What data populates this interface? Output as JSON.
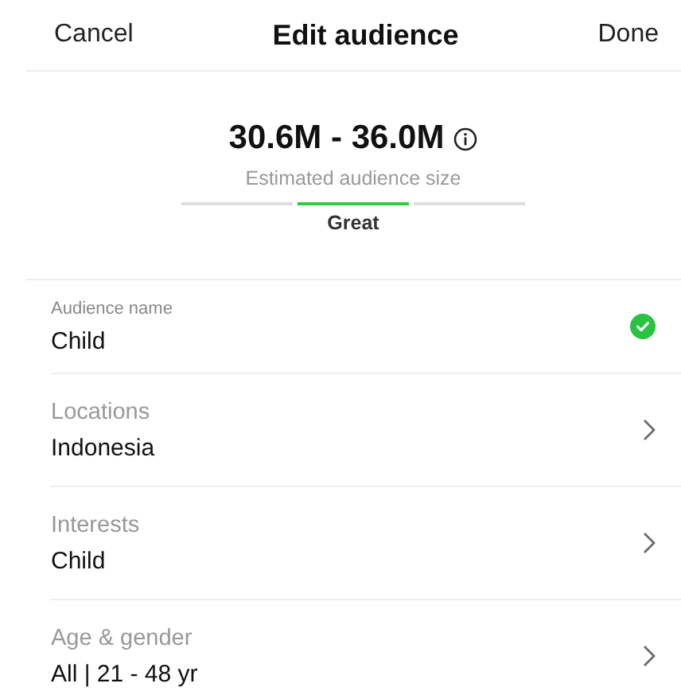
{
  "header": {
    "cancel": "Cancel",
    "title": "Edit audience",
    "done": "Done"
  },
  "estimate": {
    "range": "30.6M - 36.0M",
    "caption": "Estimated audience size",
    "segments": [
      {
        "selected": false
      },
      {
        "selected": true
      },
      {
        "selected": false
      }
    ],
    "rating": "Great"
  },
  "fields": [
    {
      "kind": "name",
      "label": "Audience name",
      "value": "Child",
      "valid": true
    },
    {
      "kind": "link",
      "label": "Locations",
      "value": "Indonesia"
    },
    {
      "kind": "link",
      "label": "Interests",
      "value": "Child"
    },
    {
      "kind": "link",
      "label": "Age & gender",
      "value": "All | 21 - 48 yr"
    }
  ]
}
